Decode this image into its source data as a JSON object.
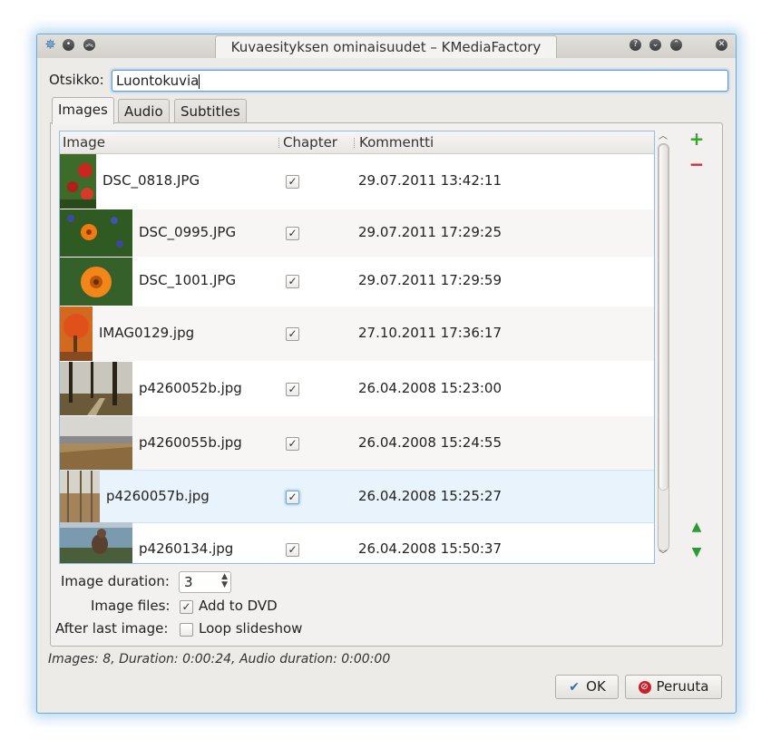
{
  "window": {
    "title": "Kuvaesityksen ominaisuudet – KMediaFactory"
  },
  "form": {
    "title_label": "Otsikko:",
    "title_value": "Luontokuvia"
  },
  "tabs": [
    {
      "label": "Images",
      "active": true
    },
    {
      "label": "Audio",
      "active": false
    },
    {
      "label": "Subtitles",
      "active": false
    }
  ],
  "table": {
    "columns": [
      "Image",
      "Chapter",
      "Kommentti"
    ],
    "rows": [
      {
        "file": "DSC_0818.JPG",
        "chapter": true,
        "comment": "29.07.2011 13:42:11"
      },
      {
        "file": "DSC_0995.JPG",
        "chapter": true,
        "comment": "29.07.2011 17:29:25"
      },
      {
        "file": "DSC_1001.JPG",
        "chapter": true,
        "comment": "29.07.2011 17:29:59"
      },
      {
        "file": "IMAG0129.jpg",
        "chapter": true,
        "comment": "27.10.2011 17:36:17"
      },
      {
        "file": "p4260052b.jpg",
        "chapter": true,
        "comment": "26.04.2008 15:23:00"
      },
      {
        "file": "p4260055b.jpg",
        "chapter": true,
        "comment": "26.04.2008 15:24:55"
      },
      {
        "file": "p4260057b.jpg",
        "chapter": true,
        "comment": "26.04.2008 15:25:27",
        "selected": true
      },
      {
        "file": "p4260134.jpg",
        "chapter": true,
        "comment": "26.04.2008 15:50:37"
      }
    ]
  },
  "options": {
    "duration_label": "Image duration:",
    "duration_value": "3",
    "image_files_label": "Image files:",
    "add_to_dvd_label": "Add to DVD",
    "add_to_dvd_checked": true,
    "after_last_label": "After last image:",
    "loop_label": "Loop slideshow",
    "loop_checked": false
  },
  "status": "Images: 8, Duration: 0:00:24, Audio duration: 0:00:00",
  "buttons": {
    "ok": "OK",
    "cancel": "Peruuta"
  },
  "colors": {
    "accent": "#6aa9d8",
    "add": "#3aa12f",
    "remove": "#d7263d",
    "move": "#2e9a36"
  },
  "icons": {
    "add": "plus-icon",
    "remove": "minus-icon",
    "up": "arrow-up-icon",
    "down": "arrow-down-icon",
    "ok": "check-icon",
    "cancel": "cancel-icon"
  }
}
